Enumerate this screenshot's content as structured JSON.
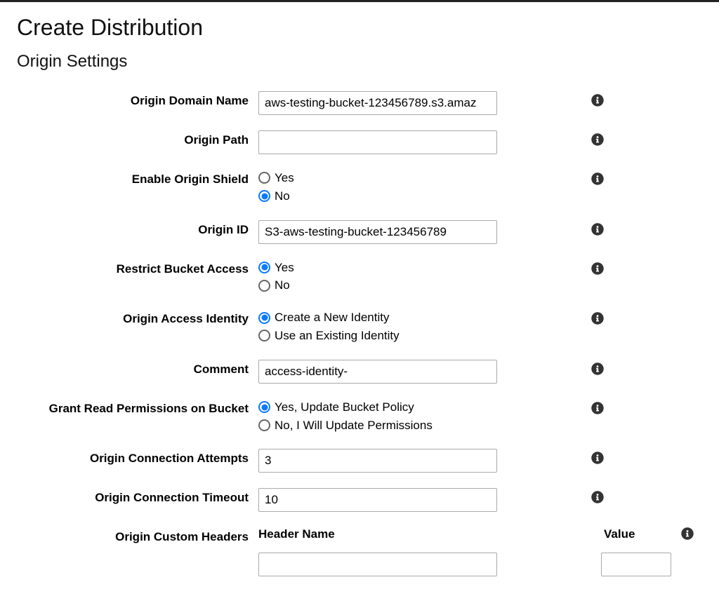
{
  "page": {
    "title": "Create Distribution",
    "section": "Origin Settings"
  },
  "fields": {
    "origin_domain_name": {
      "label": "Origin Domain Name",
      "value": "aws-testing-bucket-123456789.s3.amaz"
    },
    "origin_path": {
      "label": "Origin Path",
      "value": ""
    },
    "enable_origin_shield": {
      "label": "Enable Origin Shield",
      "options": {
        "yes": "Yes",
        "no": "No"
      },
      "selected": "no"
    },
    "origin_id": {
      "label": "Origin ID",
      "value": "S3-aws-testing-bucket-123456789"
    },
    "restrict_bucket_access": {
      "label": "Restrict Bucket Access",
      "options": {
        "yes": "Yes",
        "no": "No"
      },
      "selected": "yes"
    },
    "origin_access_identity": {
      "label": "Origin Access Identity",
      "options": {
        "create": "Create a New Identity",
        "use": "Use an Existing Identity"
      },
      "selected": "create"
    },
    "comment": {
      "label": "Comment",
      "value": "access-identity-"
    },
    "grant_read_permissions": {
      "label": "Grant Read Permissions on Bucket",
      "options": {
        "yes": "Yes, Update Bucket Policy",
        "no": "No, I Will Update Permissions"
      },
      "selected": "yes"
    },
    "origin_connection_attempts": {
      "label": "Origin Connection Attempts",
      "value": "3"
    },
    "origin_connection_timeout": {
      "label": "Origin Connection Timeout",
      "value": "10"
    },
    "origin_custom_headers": {
      "label": "Origin Custom Headers",
      "header_name_label": "Header Name",
      "value_label": "Value",
      "header_name_value": "",
      "value_value": ""
    }
  }
}
